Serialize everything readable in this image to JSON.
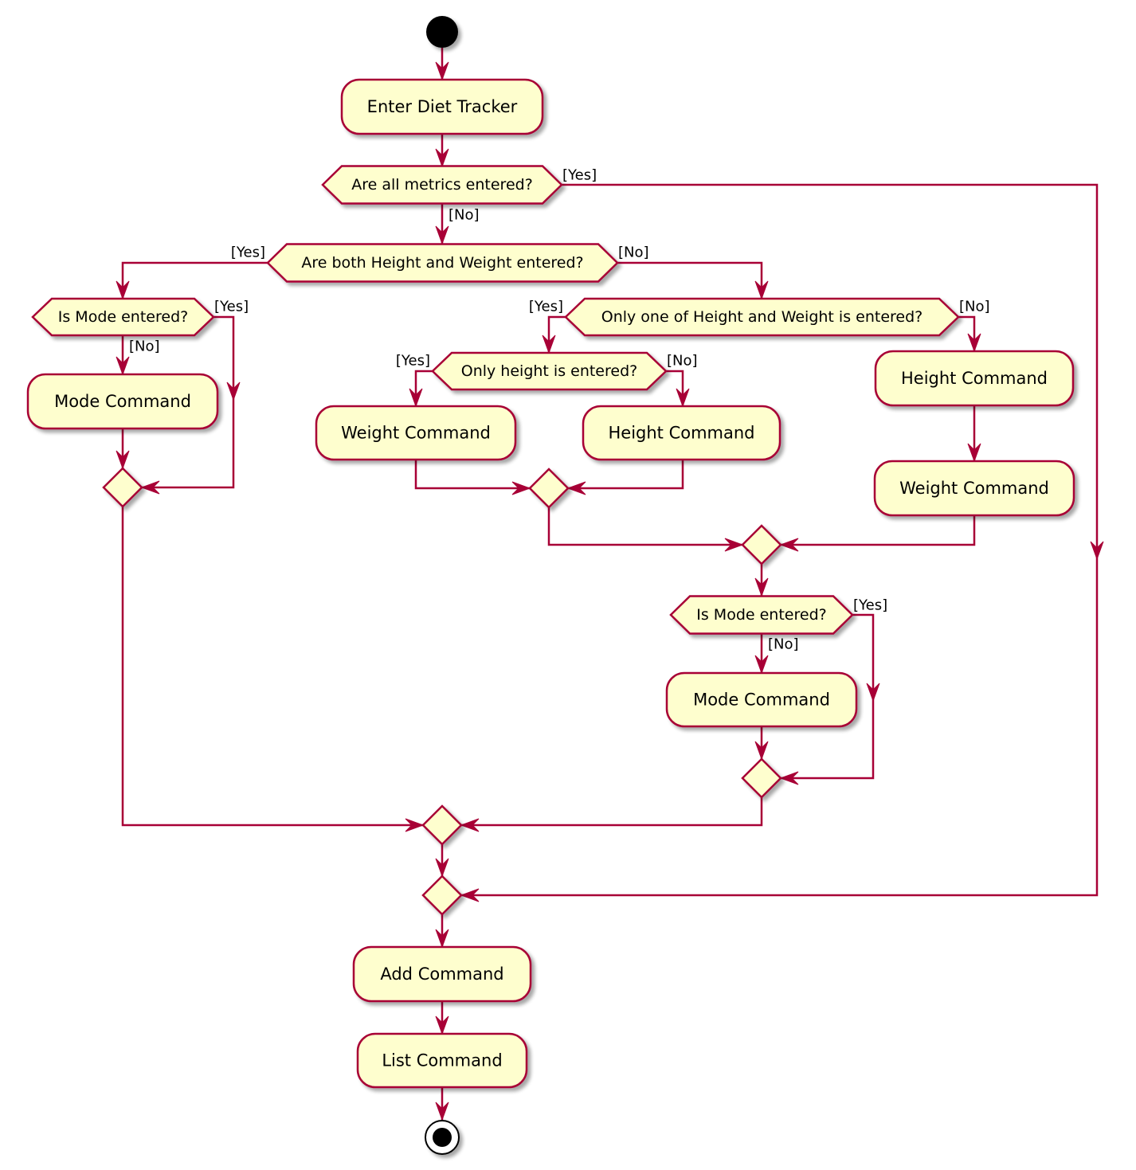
{
  "diagram": {
    "type": "activity",
    "colors": {
      "border": "#A80036",
      "fill": "#FEFECE",
      "arrow": "#A80036",
      "text": "#000000",
      "start": "#000000"
    },
    "nodes": {
      "enter": "Enter Diet Tracker",
      "all_metrics": "Are all metrics entered?",
      "both_hw": "Are both Height and Weight entered?",
      "mode_left": "Is Mode entered?",
      "mode_cmd_left": "Mode Command",
      "only_one": "Only one of Height and Weight is entered?",
      "only_height": "Only height is entered?",
      "weight_cmd_mid": "Weight Command",
      "height_cmd_mid": "Height Command",
      "height_cmd_right": "Height Command",
      "weight_cmd_right": "Weight Command",
      "mode_right": "Is Mode entered?",
      "mode_cmd_right": "Mode Command",
      "add_cmd": "Add Command",
      "list_cmd": "List Command"
    },
    "guards": {
      "all_metrics_yes": "[Yes]",
      "all_metrics_no": "[No]",
      "both_hw_yes": "[Yes]",
      "both_hw_no": "[No]",
      "mode_left_yes": "[Yes]",
      "mode_left_no": "[No]",
      "only_one_yes": "[Yes]",
      "only_one_no": "[No]",
      "only_height_yes": "[Yes]",
      "only_height_no": "[No]",
      "mode_right_yes": "[Yes]",
      "mode_right_no": "[No]"
    }
  }
}
